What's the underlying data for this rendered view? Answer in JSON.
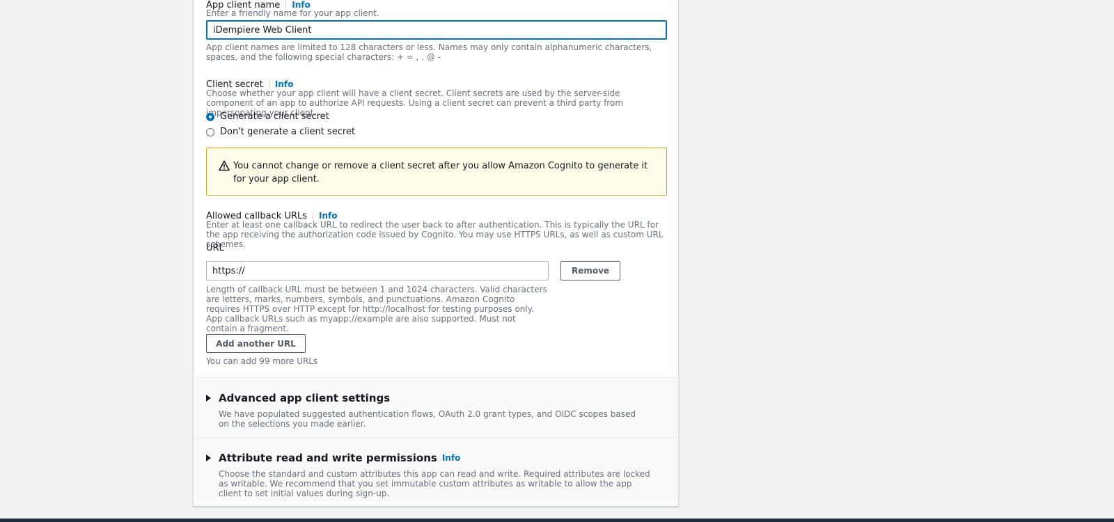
{
  "app_client_name": {
    "label": "App client name",
    "info": "Info",
    "description": "Enter a friendly name for your app client.",
    "value": "iDempiere Web Client",
    "constraint": "App client names are limited to 128 characters or less. Names may only contain alphanumeric characters, spaces, and the following special characters: + = , . @ -"
  },
  "client_secret": {
    "label": "Client secret",
    "info": "Info",
    "description": "Choose whether your app client will have a client secret. Client secrets are used by the server-side component of an app to authorize API requests. Using a client secret can prevent a third party from impersonating your client.",
    "options": [
      {
        "label": "Generate a client secret",
        "checked": true
      },
      {
        "label": "Don't generate a client secret",
        "checked": false
      }
    ],
    "warning": "You cannot change or remove a client secret after you allow Amazon Cognito to generate it for your app client."
  },
  "callback_urls": {
    "label": "Allowed callback URLs",
    "info": "Info",
    "description": "Enter at least one callback URL to redirect the user back to after authentication. This is typically the URL for the app receiving the authorization code issued by Cognito. You may use HTTPS URLs, as well as custom URL schemes.",
    "url_label": "URL",
    "url_value": "https://",
    "remove_label": "Remove",
    "constraint": "Length of callback URL must be between 1 and 1024 characters. Valid characters are letters, marks, numbers, symbols, and punctuations. Amazon Cognito requires HTTPS over HTTP except for http://localhost for testing purposes only. App callback URLs such as myapp://example are also supported. Must not contain a fragment.",
    "add_label": "Add another URL",
    "remaining": "You can add 99 more URLs"
  },
  "advanced": {
    "title": "Advanced app client settings",
    "description": "We have populated suggested authentication flows, OAuth 2.0 grant types, and OIDC scopes based on the selections you made earlier."
  },
  "attributes": {
    "title": "Attribute read and write permissions",
    "info": "Info",
    "description": "Choose the standard and custom attributes this app can read and write. Required attributes are locked as writable. We recommend that you set immutable custom attributes as writable to allow the app client to set initial values during sign-up."
  },
  "colors": {
    "accent": "#0073bb",
    "warning_border": "#d7a620",
    "warning_bg": "#fffce9"
  }
}
